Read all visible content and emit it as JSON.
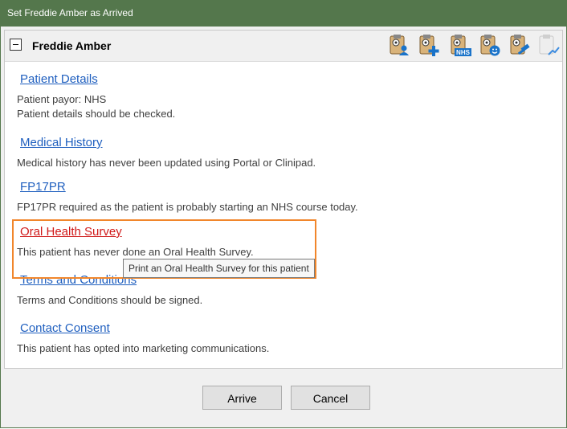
{
  "window": {
    "title": "Set Freddie Amber as Arrived"
  },
  "panel": {
    "title": "Freddie Amber",
    "toolbar_icons": [
      "clipboard-person-icon",
      "clipboard-add-icon",
      "clipboard-nhs-icon",
      "clipboard-smile-icon",
      "clipboard-gavel-icon",
      "clipboard-chart-icon"
    ],
    "nhs_badge": "NHS"
  },
  "sections": [
    {
      "title": "Patient Details",
      "lines": [
        "Patient payor: NHS",
        "Patient details should be checked."
      ]
    },
    {
      "title": "Medical History",
      "lines": [
        "Medical history has never been updated using Portal or Clinipad."
      ]
    },
    {
      "title": "FP17PR",
      "lines": [
        "FP17PR required as the patient is probably starting an NHS course today."
      ]
    },
    {
      "title": "Oral Health Survey",
      "lines": [
        "This patient has never done an Oral Health Survey."
      ]
    },
    {
      "title": "Terms and Conditions",
      "lines": [
        "Terms and Conditions should be signed."
      ]
    },
    {
      "title": "Contact Consent",
      "lines": [
        "This patient has opted into marketing communications."
      ]
    }
  ],
  "tooltip": "Print an Oral Health Survey for this patient",
  "buttons": {
    "arrive": "Arrive",
    "cancel": "Cancel"
  },
  "colors": {
    "title_bar": "#54774c",
    "link": "#1f5fbf",
    "link_active": "#d01919",
    "highlight": "#f1862b"
  }
}
